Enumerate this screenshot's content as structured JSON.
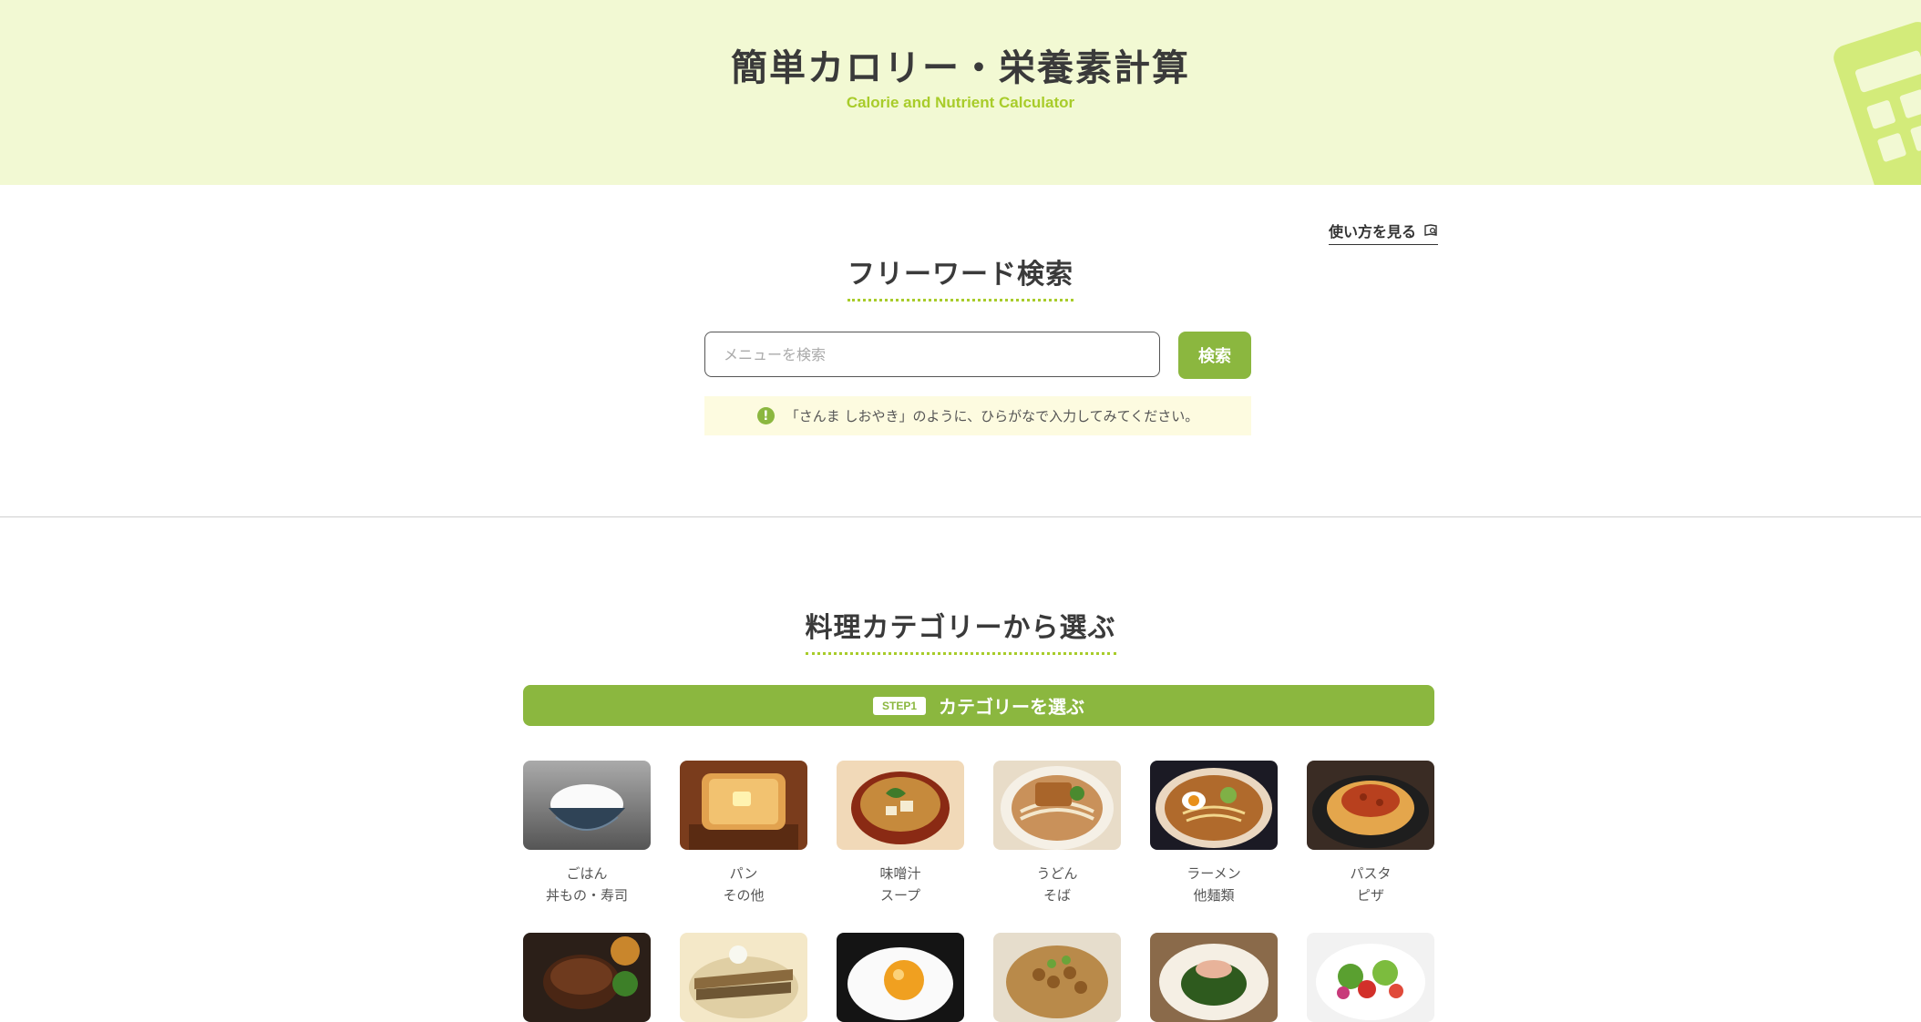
{
  "header": {
    "title": "簡単カロリー・栄養素計算",
    "subtitle": "Calorie and Nutrient Calculator"
  },
  "howto": {
    "label": "使い方を見る",
    "icon": "book-icon"
  },
  "search": {
    "section_title": "フリーワード検索",
    "placeholder": "メニューを検索",
    "value": "",
    "button_label": "検索",
    "hint_icon": "!",
    "hint": "「さんま しおやき」のように、ひらがなで入力してみてください。"
  },
  "category": {
    "section_title": "料理カテゴリーから選ぶ",
    "step_badge": "STEP1",
    "step_label": "カテゴリーを選ぶ",
    "items": [
      {
        "line1": "ごはん",
        "line2": "丼もの・寿司",
        "image": "rice-bowl"
      },
      {
        "line1": "パン",
        "line2": "その他",
        "image": "toast"
      },
      {
        "line1": "味噌汁",
        "line2": "スープ",
        "image": "miso-soup"
      },
      {
        "line1": "うどん",
        "line2": "そば",
        "image": "udon"
      },
      {
        "line1": "ラーメン",
        "line2": "他麺類",
        "image": "ramen"
      },
      {
        "line1": "パスタ",
        "line2": "ピザ",
        "image": "pasta"
      },
      {
        "line1": "",
        "line2": "",
        "image": "hamburg-steak"
      },
      {
        "line1": "",
        "line2": "",
        "image": "grilled-fish"
      },
      {
        "line1": "",
        "line2": "",
        "image": "fried-egg"
      },
      {
        "line1": "",
        "line2": "",
        "image": "natto"
      },
      {
        "line1": "",
        "line2": "",
        "image": "spinach-ohitashi"
      },
      {
        "line1": "",
        "line2": "",
        "image": "salad"
      }
    ]
  },
  "colors": {
    "hero_bg": "#f2f9d3",
    "accent": "#8bb73f",
    "accent_light": "#a8cc2a",
    "hint_bg": "#fdfbe0"
  }
}
